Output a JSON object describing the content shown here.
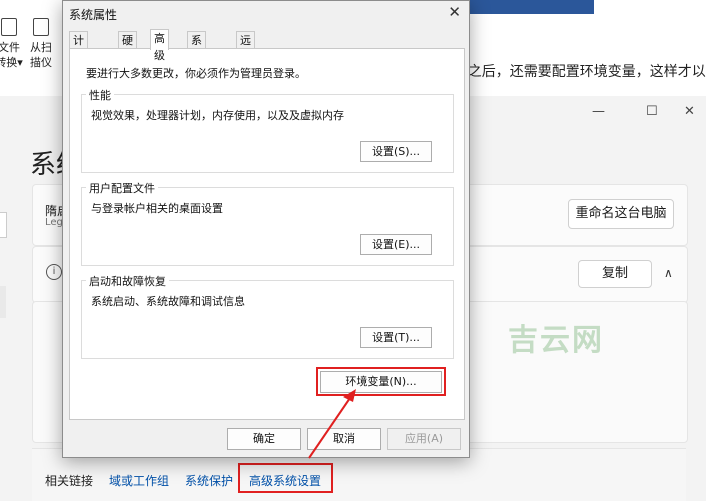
{
  "word": {
    "ribbon_items": [
      {
        "line1": "文件",
        "line2": "转换"
      },
      {
        "line1": "从扫",
        "line2": "描仪"
      }
    ],
    "doc_text": "L之后，还需要配置环境变量，这样才以"
  },
  "settings": {
    "title": "系统",
    "device_name": "隋启",
    "device_sub": "Legi",
    "rename_button": "重命名这台电脑",
    "copy_button": "复制",
    "info_glyph": "i",
    "related_label": "相关链接",
    "links": [
      "域或工作组",
      "系统保护",
      "高级系统设置"
    ]
  },
  "dialog": {
    "title": "系统属性",
    "tabs": [
      "计算机名",
      "硬件",
      "高级",
      "系统保护",
      "远程"
    ],
    "active_tab": "高级",
    "admin_note": "要进行大多数更改，你必须作为管理员登录。",
    "groups": [
      {
        "label": "性能",
        "desc": "视觉效果，处理器计划，内存使用，以及及虚拟内存",
        "button": "设置(S)..."
      },
      {
        "label": "用户配置文件",
        "desc": "与登录帐户相关的桌面设置",
        "button": "设置(E)..."
      },
      {
        "label": "启动和故障恢复",
        "desc": "系统启动、系统故障和调试信息",
        "button": "设置(T)..."
      }
    ],
    "env_button": "环境变量(N)...",
    "ok_button": "确定",
    "cancel_button": "取消",
    "apply_button": "应用(A)"
  },
  "watermark": "吉云网",
  "colors": {
    "highlight": "#e02020",
    "link": "#0050a8"
  }
}
